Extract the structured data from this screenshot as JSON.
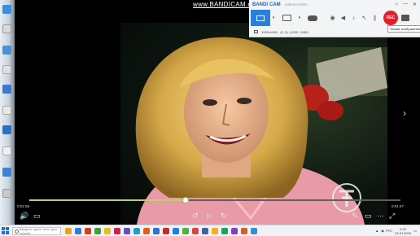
{
  "watermark": {
    "prefix": "www.",
    "brand": "BANDICAM",
    "suffix": ".com"
  },
  "bandicam": {
    "brand_left": "BANDI",
    "brand_right": "CAM",
    "registration": "UNREGISTERED",
    "status_text": "1920x1080 - (0, 0), (1920, 1080)",
    "tooltip": "Захват изображения",
    "rec_label": "REC",
    "window_buttons": [
      "⌂",
      "—",
      "✕"
    ],
    "colors": {
      "active_mode": "#2b7fd8",
      "rec": "#e0202a"
    }
  },
  "player": {
    "time_current": "0:01:06",
    "time_total": "0:01:47",
    "progress": 0.42,
    "buttons": {
      "volume": "🔊",
      "subtitles": "▭",
      "rewind": "↺",
      "play": "▷",
      "forward": "↻",
      "edit": "✎",
      "screen": "▭",
      "more": "⋯",
      "fullscreen": "⤢"
    },
    "prev_arrow": "‹",
    "next_arrow": "›"
  },
  "taskbar": {
    "search_placeholder": "Введите здесь текст для поиска",
    "language": "РУС",
    "time": "0:22",
    "date": "24.01.2019",
    "apps": [
      "#e8a020",
      "#2b7fd8",
      "#d04020",
      "#40a040",
      "#e0c020",
      "#d02050",
      "#6050c0",
      "#20a0c0",
      "#e06020",
      "#3070d0",
      "#c03030",
      "#2080e0",
      "#50b040",
      "#e04040",
      "#4060a0",
      "#f0b020",
      "#20a060",
      "#8040c0",
      "#d06030",
      "#3090d0"
    ]
  }
}
